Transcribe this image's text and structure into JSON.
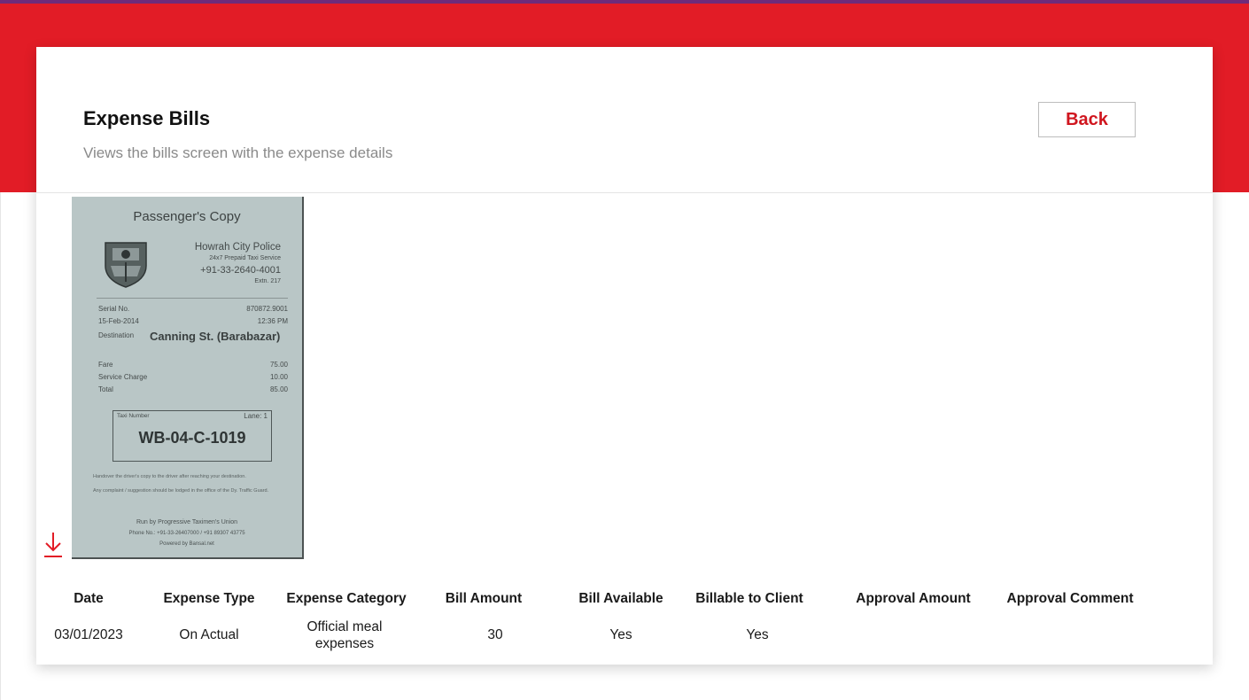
{
  "header": {
    "title": "Expense Bills",
    "subtitle": "Views the bills screen with the expense details",
    "back_label": "Back"
  },
  "colors": {
    "brand_red": "#e21c26",
    "accent_red_text": "#d0161f",
    "top_strip": "#6f2b7a"
  },
  "download": {
    "icon": "download-icon"
  },
  "receipt": {
    "title": "Passenger's Copy",
    "org_name": "Howrah City Police",
    "org_service": "24x7 Prepaid Taxi Service",
    "org_phone": "+91-33-2640-4001",
    "org_ext": "Extn. 217",
    "serial_label": "Serial No.",
    "serial_value": "870872.9001",
    "date": "15-Feb-2014",
    "time": "12:36 PM",
    "destination_label": "Destination",
    "destination": "Canning St. (Barabazar)",
    "fare_label": "Fare",
    "fare_value": "75.00",
    "service_label": "Service Charge",
    "service_value": "10.00",
    "total_label": "Total",
    "total_value": "85.00",
    "taxi_label": "Taxi Number",
    "lane": "Lane: 1",
    "plate": "WB-04-C-1019",
    "note1": "Handover the driver's copy to the driver after reaching your destination.",
    "note2": "Any complaint / suggestion should be lodged in the office of the Dy. Traffic Guard.",
    "footer1": "Run by Progressive Taximen's Union",
    "footer2": "Phone No.: +91-33-26407000 / +91 89307 43775",
    "footer3": "Powered by Bansal.net"
  },
  "table": {
    "columns": [
      "Date",
      "Expense Type",
      "Expense Category",
      "Bill Amount",
      "Bill Available",
      "Billable to Client",
      "Approval Amount",
      "Approval Comment"
    ],
    "row": {
      "date": "03/01/2023",
      "expense_type": "On Actual",
      "category_line1": "Official meal",
      "category_line2": "expenses",
      "bill_amount": "30",
      "bill_available": "Yes",
      "billable_to_client": "Yes",
      "approval_amount": "",
      "approval_comment": ""
    }
  }
}
